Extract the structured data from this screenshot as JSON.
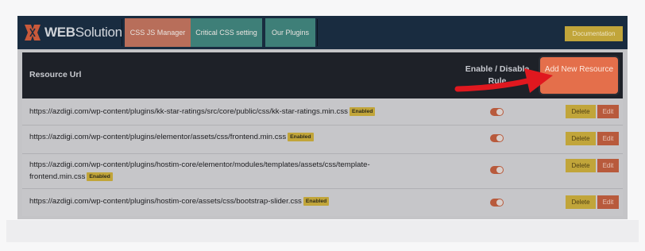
{
  "header": {
    "logo_text": "WEBSolution",
    "logo_text_strong": "WEB",
    "logo_text_rest": "Solution",
    "tabs": [
      {
        "label": "CSS JS Manager"
      },
      {
        "label": "Critical CSS setting"
      },
      {
        "label": "Our Plugins"
      }
    ],
    "documentation_label": "Documentation"
  },
  "table": {
    "col_url": "Resource Url",
    "col_rule": "Enable / Disable Rule",
    "add_button": "Add New Resource",
    "delete_label": "Delete",
    "edit_label": "Edit",
    "rows": [
      {
        "url": "https://azdigi.com/wp-content/plugins/kk-star-ratings/src/core/public/css/kk-star-ratings.min.css",
        "badge": "Enabled",
        "toggle_on": true
      },
      {
        "url": "https://azdigi.com/wp-content/plugins/elementor/assets/css/frontend.min.css",
        "badge": "Enabled",
        "toggle_on": true
      },
      {
        "url": "https://azdigi.com/wp-content/plugins/hostim-core/elementor/modules/templates/assets/css/template-frontend.min.css",
        "badge": "Enabled",
        "toggle_on": true
      },
      {
        "url": "https://azdigi.com/wp-content/plugins/hostim-core/assets/css/bootstrap-slider.css",
        "badge": "Enabled",
        "toggle_on": true
      }
    ]
  },
  "colors": {
    "nav_bg": "#192c40",
    "tab_active": "#b86e5a",
    "tab_inactive": "#3e7f78",
    "accent_yellow": "#c1a53a",
    "accent_red": "#b85a3c",
    "add_button": "#e46f4b",
    "arrow": "#e0181f"
  }
}
